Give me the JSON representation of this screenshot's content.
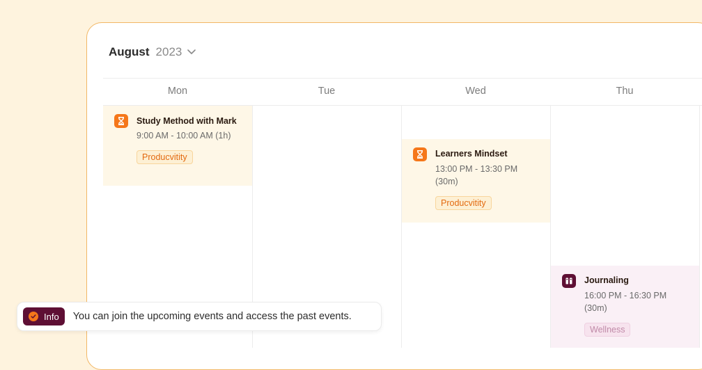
{
  "calendar": {
    "month": "August",
    "year": "2023",
    "days": [
      "Mon",
      "Tue",
      "Wed",
      "Thu"
    ]
  },
  "events": [
    {
      "title": "Study Method with Mark",
      "time": "9:00 AM - 10:00 AM (1h)",
      "tag": "Producvitity",
      "icon": "hourglass-icon",
      "color": "#f5771a"
    },
    {
      "title": "Learners Mindset",
      "time": "13:00 PM - 13:30 PM (30m)",
      "tag": "Producvitity",
      "icon": "hourglass-icon",
      "color": "#f5771a"
    },
    {
      "title": "Journaling",
      "time": "16:00 PM - 16:30 PM (30m)",
      "tag": "Wellness",
      "icon": "journal-icon",
      "color": "#5e0f34"
    }
  ],
  "toast": {
    "badge": "Info",
    "message": "You can join the upcoming events and access the past events."
  },
  "colors": {
    "accent": "#f5771a",
    "plum": "#5e0f34",
    "background": "#fef3de"
  }
}
